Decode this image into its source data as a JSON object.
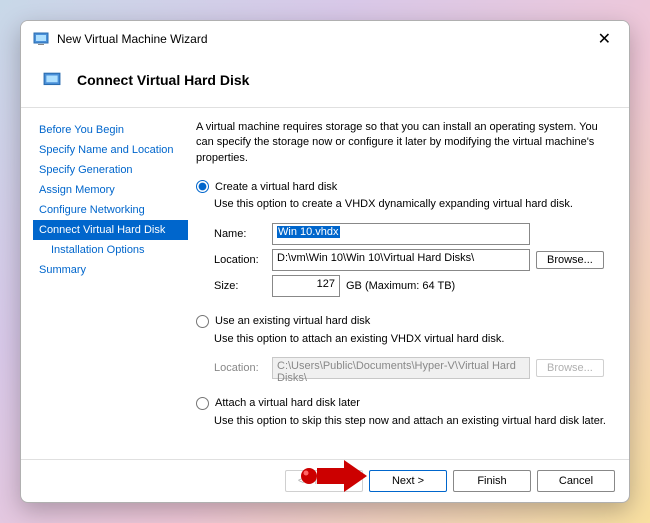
{
  "window": {
    "title": "New Virtual Machine Wizard"
  },
  "header": {
    "title": "Connect Virtual Hard Disk"
  },
  "sidebar": {
    "steps": [
      "Before You Begin",
      "Specify Name and Location",
      "Specify Generation",
      "Assign Memory",
      "Configure Networking",
      "Connect Virtual Hard Disk",
      "Installation Options",
      "Summary"
    ],
    "selected_index": 5,
    "indent_index": 6
  },
  "content": {
    "intro": "A virtual machine requires storage so that you can install an operating system. You can specify the storage now or configure it later by modifying the virtual machine's properties.",
    "opt1": {
      "label": "Create a virtual hard disk",
      "desc": "Use this option to create a VHDX dynamically expanding virtual hard disk.",
      "fields": {
        "name_label": "Name:",
        "name_value": "Win 10.vhdx",
        "location_label": "Location:",
        "location_value": "D:\\vm\\Win 10\\Win 10\\Virtual Hard Disks\\",
        "browse": "Browse...",
        "size_label": "Size:",
        "size_value": "127",
        "size_suffix": "GB (Maximum: 64 TB)"
      }
    },
    "opt2": {
      "label": "Use an existing virtual hard disk",
      "desc": "Use this option to attach an existing VHDX virtual hard disk.",
      "fields": {
        "location_label": "Location:",
        "location_value": "C:\\Users\\Public\\Documents\\Hyper-V\\Virtual Hard Disks\\",
        "browse": "Browse..."
      }
    },
    "opt3": {
      "label": "Attach a virtual hard disk later",
      "desc": "Use this option to skip this step now and attach an existing virtual hard disk later."
    }
  },
  "footer": {
    "previous": "< Previous",
    "next": "Next >",
    "finish": "Finish",
    "cancel": "Cancel"
  }
}
